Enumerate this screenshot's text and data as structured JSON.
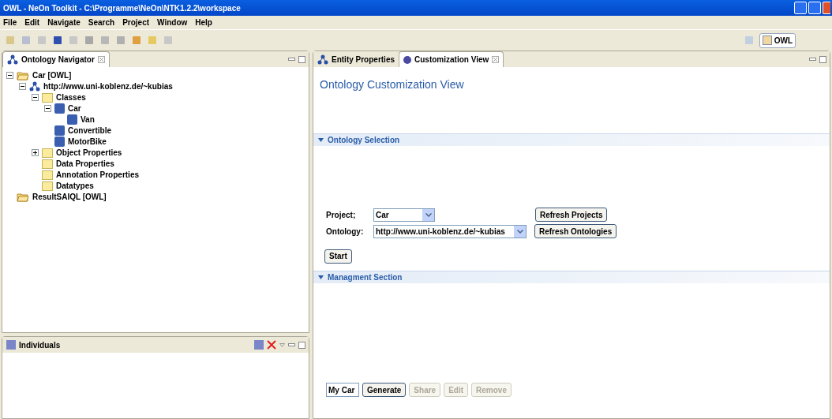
{
  "window": {
    "title": "OWL - NeOn Toolkit - C:\\Programme\\NeOn\\NTK1.2.2\\workspace"
  },
  "menu": [
    "File",
    "Edit",
    "Navigate",
    "Search",
    "Project",
    "Window",
    "Help"
  ],
  "perspective": {
    "label": "OWL"
  },
  "navigator": {
    "tab": {
      "label": "Ontology Navigator",
      "selected": true
    },
    "tree": [
      {
        "label": "Car [OWL]",
        "kind": "project",
        "expanded": true,
        "children": [
          {
            "label": "http://www.uni-koblenz.de/~kubias",
            "kind": "ontology",
            "expanded": true,
            "children": [
              {
                "label": "Classes",
                "kind": "folder",
                "expanded": true,
                "children": [
                  {
                    "label": "Car",
                    "kind": "class",
                    "expanded": true,
                    "children": [
                      {
                        "label": "Van",
                        "kind": "class"
                      }
                    ]
                  },
                  {
                    "label": "Convertible",
                    "kind": "class"
                  },
                  {
                    "label": "MotorBike",
                    "kind": "class"
                  }
                ]
              },
              {
                "label": "Object Properties",
                "kind": "folder",
                "expanded": false
              },
              {
                "label": "Data Properties",
                "kind": "folder"
              },
              {
                "label": "Annotation Properties",
                "kind": "folder"
              },
              {
                "label": "Datatypes",
                "kind": "folder"
              }
            ]
          }
        ]
      },
      {
        "label": "ResultSAIQL [OWL]",
        "kind": "project"
      }
    ]
  },
  "individuals": {
    "tab": {
      "label": "Individuals",
      "selected": false
    }
  },
  "editor_tabs": [
    {
      "label": "Entity Properties",
      "selected": false
    },
    {
      "label": "Customization View",
      "selected": true
    }
  ],
  "view": {
    "title": "Ontology Customization View",
    "selection_section": {
      "title": "Ontology Selection",
      "expanded": true,
      "project": {
        "label": "Project;",
        "value": "Car"
      },
      "ontology": {
        "label": "Ontology:",
        "value": "http://www.uni-koblenz.de/~kubias"
      },
      "refresh_projects": "Refresh Projects",
      "refresh_ontologies": "Refresh Ontologies",
      "start": "Start"
    },
    "management_section": {
      "title": "Managment Section",
      "expanded": true,
      "name_value": "My Car",
      "buttons": [
        {
          "label": "Generate",
          "disabled": false
        },
        {
          "label": "Share",
          "disabled": true
        },
        {
          "label": "Edit",
          "disabled": true
        },
        {
          "label": "Remove",
          "disabled": true
        }
      ]
    }
  }
}
